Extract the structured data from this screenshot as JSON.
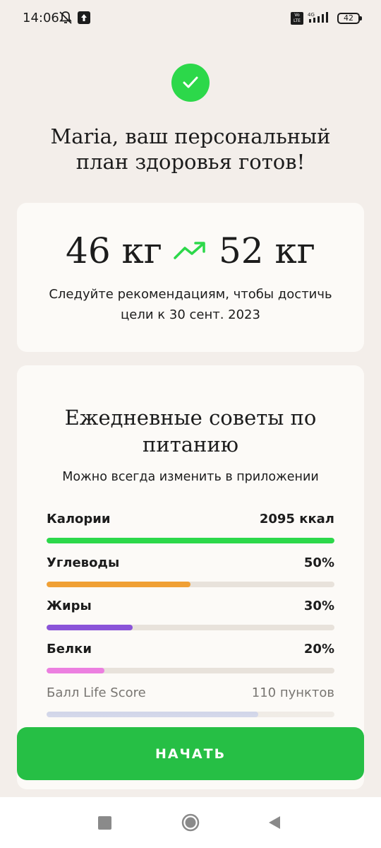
{
  "status_bar": {
    "time": "14:06",
    "network": "4G",
    "volte": "Vo LTE",
    "battery": "42",
    "icons": [
      "bell-off-icon",
      "upload-icon",
      "volte-icon",
      "signal-icon",
      "battery-icon"
    ]
  },
  "header": {
    "check_icon": "check-circle-icon",
    "title": "Maria, ваш персональный план здоровья готов!"
  },
  "goal": {
    "current_weight": "46 кг",
    "target_weight": "52 кг",
    "trend_icon": "trend-up-icon",
    "description": "Следуйте рекомендациям, чтобы достичь цели к 30 сент. 2023"
  },
  "nutrition": {
    "title": "Ежедневные советы по питанию",
    "subtitle": "Можно всегда изменить в приложении",
    "metrics": [
      {
        "label": "Калории",
        "value": "2095 ккал",
        "fill": 1.0,
        "color": "#2cd84a"
      },
      {
        "label": "Углеводы",
        "value": "50%",
        "fill": 0.5,
        "color": "#f0a035"
      },
      {
        "label": "Жиры",
        "value": "30%",
        "fill": 0.3,
        "color": "#8a54d8"
      },
      {
        "label": "Белки",
        "value": "20%",
        "fill": 0.2,
        "color": "#ec7fe0"
      },
      {
        "label": "Балл Life Score",
        "value": "110 пунктов",
        "fill": 0.735,
        "color": "#b7bfe0"
      }
    ]
  },
  "actions": {
    "start_label": "НАЧАТЬ"
  },
  "colors": {
    "background": "#f3eeea",
    "card": "#fcfaf7",
    "accent_green": "#26bf45"
  },
  "nav": {
    "icons": [
      "recents-square-icon",
      "home-circle-icon",
      "back-triangle-icon"
    ]
  }
}
